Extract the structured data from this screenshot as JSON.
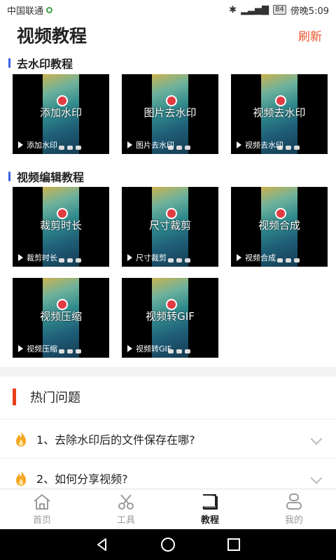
{
  "status_bar": {
    "carrier": "中国联通",
    "battery": "84",
    "time": "傍晚5:09"
  },
  "header": {
    "title": "视频教程",
    "refresh_label": "刷新"
  },
  "sections": [
    {
      "title": "去水印教程",
      "items": [
        {
          "title": "添加水印",
          "caption": "添加水印"
        },
        {
          "title": "图片去水印",
          "caption": "图片去水印"
        },
        {
          "title": "视频去水印",
          "caption": "视频去水印"
        }
      ]
    },
    {
      "title": "视频编辑教程",
      "items": [
        {
          "title": "裁剪时长",
          "caption": "裁剪时长"
        },
        {
          "title": "尺寸裁剪",
          "caption": "尺寸裁剪"
        },
        {
          "title": "视频合成",
          "caption": "视频合成"
        },
        {
          "title": "视频压缩",
          "caption": "视频压缩"
        },
        {
          "title": "视频转GIF",
          "caption": "视频转GIF"
        }
      ]
    }
  ],
  "hot": {
    "title": "热门问题",
    "questions": [
      "1、去除水印后的文件保存在哪?",
      "2、如何分享视频?"
    ]
  },
  "tabbar": {
    "items": [
      "首页",
      "工具",
      "教程",
      "我的"
    ],
    "active_index": 2
  }
}
